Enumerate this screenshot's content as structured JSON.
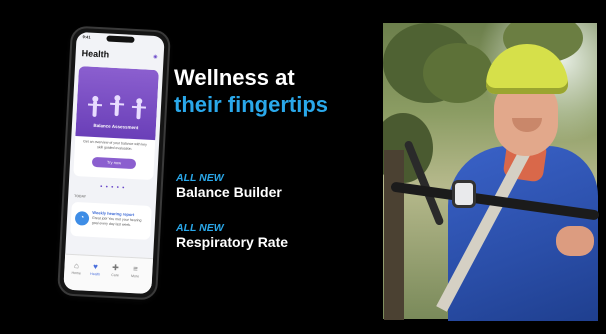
{
  "headline": {
    "line1": "Wellness at",
    "line2": "their fingertips"
  },
  "features": [
    {
      "tag": "ALL NEW",
      "name": "Balance Builder"
    },
    {
      "tag": "ALL NEW",
      "name": "Respiratory Rate"
    }
  ],
  "colors": {
    "background": "#000000",
    "accent_blue": "#2aa8ea",
    "text": "#ffffff",
    "phone_card_purple": "#8b5fcf"
  },
  "phone": {
    "status_time": "9:41",
    "app_title": "Health",
    "card": {
      "title": "Balance Assessment",
      "description": "Get an overview of your balance with key skill guided evaluation.",
      "button_label": "Try now"
    },
    "pagination_dots": "● ● ● ● ●",
    "section_label": "TODAY",
    "notification": {
      "title": "Weekly hearing report",
      "body": "Great job! You met your hearing goal every day last week."
    },
    "tabs": [
      {
        "label": "Home",
        "icon": "home-icon"
      },
      {
        "label": "Health",
        "icon": "heart-icon"
      },
      {
        "label": "Care",
        "icon": "care-icon"
      },
      {
        "label": "More",
        "icon": "menu-icon"
      }
    ]
  }
}
